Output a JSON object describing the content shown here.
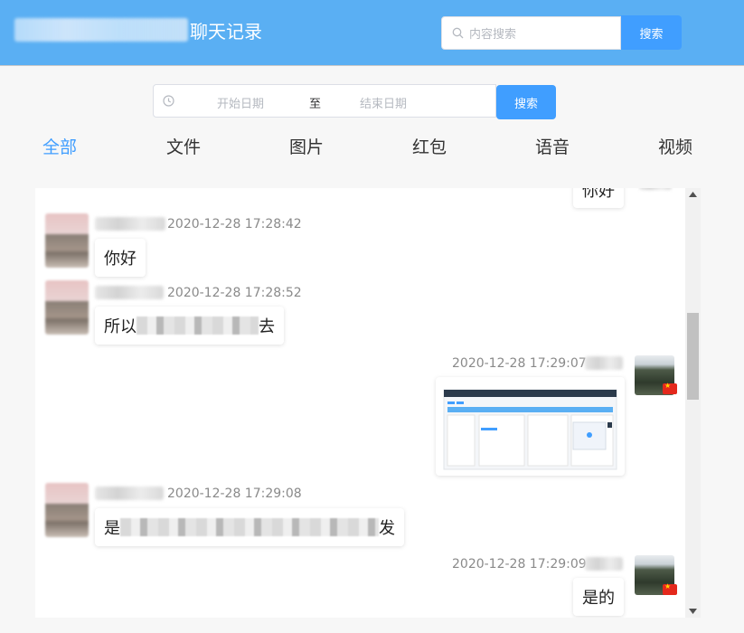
{
  "header": {
    "title": "聊天记录",
    "search_placeholder": "内容搜索",
    "search_button": "搜索"
  },
  "filter": {
    "start_placeholder": "开始日期",
    "separator": "至",
    "end_placeholder": "结束日期",
    "search_button": "搜索"
  },
  "tabs": [
    "全部",
    "文件",
    "图片",
    "红包",
    "语音",
    "视频"
  ],
  "messages": [
    {
      "side": "right",
      "text": "你好"
    },
    {
      "side": "left",
      "time": "2020-12-28 17:28:42",
      "text": "你好"
    },
    {
      "side": "left",
      "time": "2020-12-28 17:28:52",
      "text_start": "所以",
      "text_end": "去"
    },
    {
      "side": "right",
      "time": "2020-12-28 17:29:07",
      "type": "image"
    },
    {
      "side": "left",
      "time": "2020-12-28 17:29:08",
      "text_start": "是",
      "text_end": "发"
    },
    {
      "side": "right",
      "time": "2020-12-28 17:29:09",
      "text": "是的"
    }
  ],
  "colors": {
    "header": "#5aaff3",
    "accent": "#409eff",
    "flag": "#e4281c"
  }
}
